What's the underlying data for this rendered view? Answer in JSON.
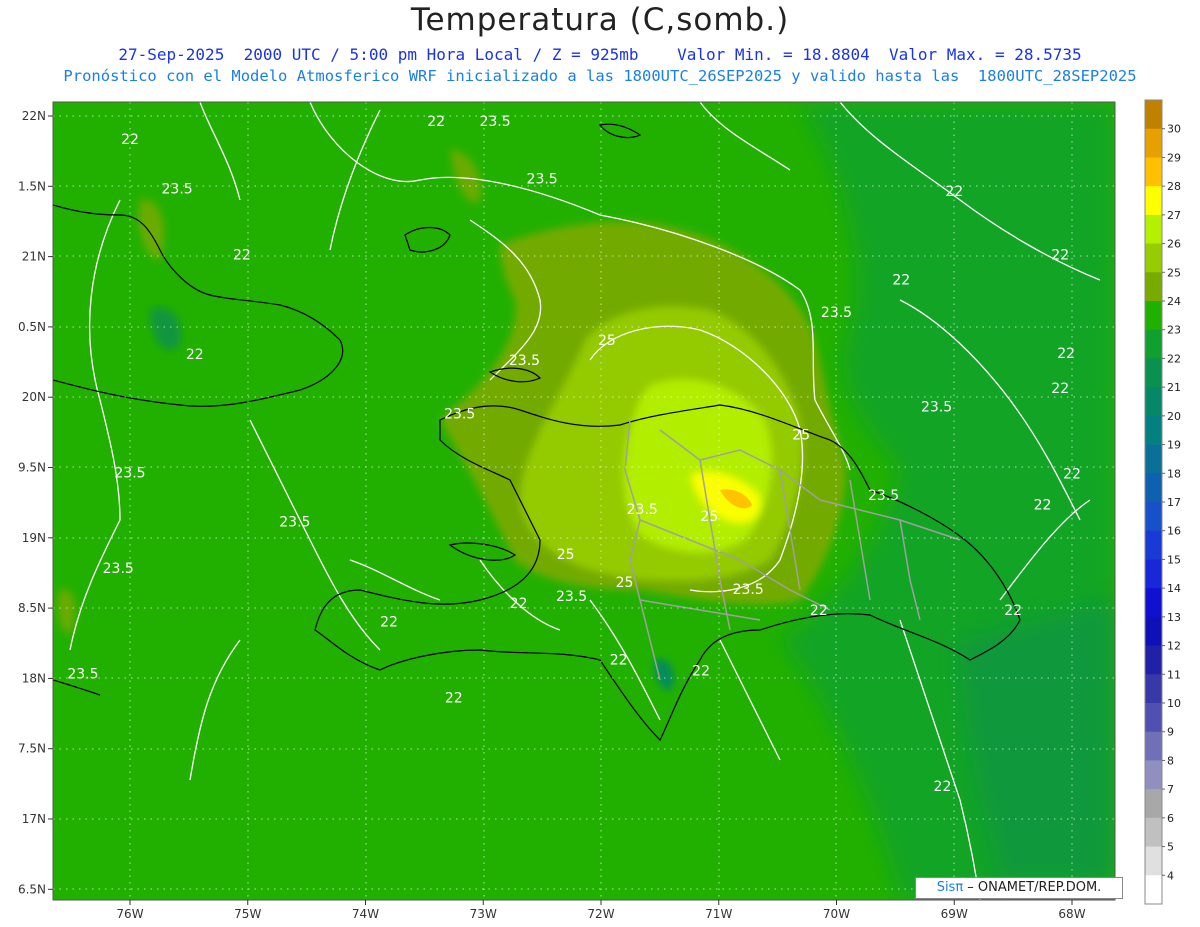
{
  "header": {
    "title": "Temperatura (C,somb.)",
    "line1": "27-Sep-2025  2000 UTC / 5:00 pm Hora Local / Z = 925mb    Valor Min. = 18.8804  Valor Max. = 28.5735",
    "line2": "Pronóstico con el Modelo Atmosferico WRF inicializado a las 1800UTC_26SEP2025 y valido hasta las  1800UTC_28SEP2025"
  },
  "axes": {
    "lat_labels": [
      "22N",
      "1.5N",
      "21N",
      "0.5N",
      "20N",
      "9.5N",
      "19N",
      "8.5N",
      "18N",
      "7.5N",
      "17N",
      "6.5N"
    ],
    "lon_labels": [
      "76W",
      "75W",
      "74W",
      "73W",
      "72W",
      "71W",
      "70W",
      "69W",
      "68W"
    ]
  },
  "colorbar": {
    "labels": [
      "30",
      "29",
      "28",
      "27",
      "26",
      "25",
      "24",
      "23",
      "22",
      "21",
      "20",
      "19",
      "18",
      "17",
      "16",
      "15",
      "14",
      "13",
      "12",
      "11",
      "10",
      "9",
      "8",
      "7",
      "6",
      "5",
      "4"
    ],
    "colors": [
      "#c08000",
      "#e6a000",
      "#ffc000",
      "#ffff00",
      "#b4f000",
      "#96cc00",
      "#78aa00",
      "#22b000",
      "#10a030",
      "#0a9050",
      "#068868",
      "#058080",
      "#0a7098",
      "#1060b0",
      "#1850c8",
      "#1a3ad6",
      "#1828d8",
      "#1010d0",
      "#1010b8",
      "#2020a8",
      "#3838a8",
      "#5050b0",
      "#7070b8",
      "#9090c0",
      "#a8a8a8",
      "#c0c0c0",
      "#e0e0e0",
      "#ffffff"
    ]
  },
  "contour_labels": [
    {
      "text": "22",
      "lon": -73.4,
      "lat": 21.93
    },
    {
      "text": "23.5",
      "lon": -72.9,
      "lat": 21.93
    },
    {
      "text": "22",
      "lon": -76.0,
      "lat": 21.8
    },
    {
      "text": "23.5",
      "lon": -75.6,
      "lat": 21.45
    },
    {
      "text": "23.5",
      "lon": -72.5,
      "lat": 21.52
    },
    {
      "text": "22",
      "lon": -69.0,
      "lat": 21.43
    },
    {
      "text": "22",
      "lon": -75.05,
      "lat": 20.98
    },
    {
      "text": "22",
      "lon": -68.1,
      "lat": 20.98
    },
    {
      "text": "22",
      "lon": -69.45,
      "lat": 20.8
    },
    {
      "text": "23.5",
      "lon": -70.0,
      "lat": 20.57
    },
    {
      "text": "25",
      "lon": -71.95,
      "lat": 20.37
    },
    {
      "text": "22",
      "lon": -75.45,
      "lat": 20.27
    },
    {
      "text": "22",
      "lon": -68.05,
      "lat": 20.28
    },
    {
      "text": "23.5",
      "lon": -72.65,
      "lat": 20.23
    },
    {
      "text": "22",
      "lon": -68.1,
      "lat": 20.03
    },
    {
      "text": "23.5",
      "lon": -69.15,
      "lat": 19.9
    },
    {
      "text": "23.5",
      "lon": -73.2,
      "lat": 19.85
    },
    {
      "text": "25",
      "lon": -70.3,
      "lat": 19.7
    },
    {
      "text": "23.5",
      "lon": -76.0,
      "lat": 19.43
    },
    {
      "text": "22",
      "lon": -68.0,
      "lat": 19.42
    },
    {
      "text": "23.5",
      "lon": -69.6,
      "lat": 19.27
    },
    {
      "text": "22",
      "lon": -68.25,
      "lat": 19.2
    },
    {
      "text": "23.5",
      "lon": -71.65,
      "lat": 19.17
    },
    {
      "text": "25",
      "lon": -71.08,
      "lat": 19.12
    },
    {
      "text": "23.5",
      "lon": -74.6,
      "lat": 19.08
    },
    {
      "text": "25",
      "lon": -72.3,
      "lat": 18.85
    },
    {
      "text": "23.5",
      "lon": -76.1,
      "lat": 18.75
    },
    {
      "text": "25",
      "lon": -71.8,
      "lat": 18.65
    },
    {
      "text": "23.5",
      "lon": -70.75,
      "lat": 18.6
    },
    {
      "text": "23.5",
      "lon": -72.25,
      "lat": 18.55
    },
    {
      "text": "22",
      "lon": -72.7,
      "lat": 18.5
    },
    {
      "text": "22",
      "lon": -70.15,
      "lat": 18.45
    },
    {
      "text": "22",
      "lon": -68.5,
      "lat": 18.45
    },
    {
      "text": "22",
      "lon": -73.8,
      "lat": 18.37
    },
    {
      "text": "22",
      "lon": -71.85,
      "lat": 18.1
    },
    {
      "text": "22",
      "lon": -71.15,
      "lat": 18.02
    },
    {
      "text": "23.5",
      "lon": -76.4,
      "lat": 18.0
    },
    {
      "text": "22",
      "lon": -73.25,
      "lat": 17.83
    },
    {
      "text": "22",
      "lon": -69.1,
      "lat": 17.2
    }
  ],
  "credit": {
    "sis": "Sisπ",
    "rest": " – ONAMET/REP.DOM."
  }
}
